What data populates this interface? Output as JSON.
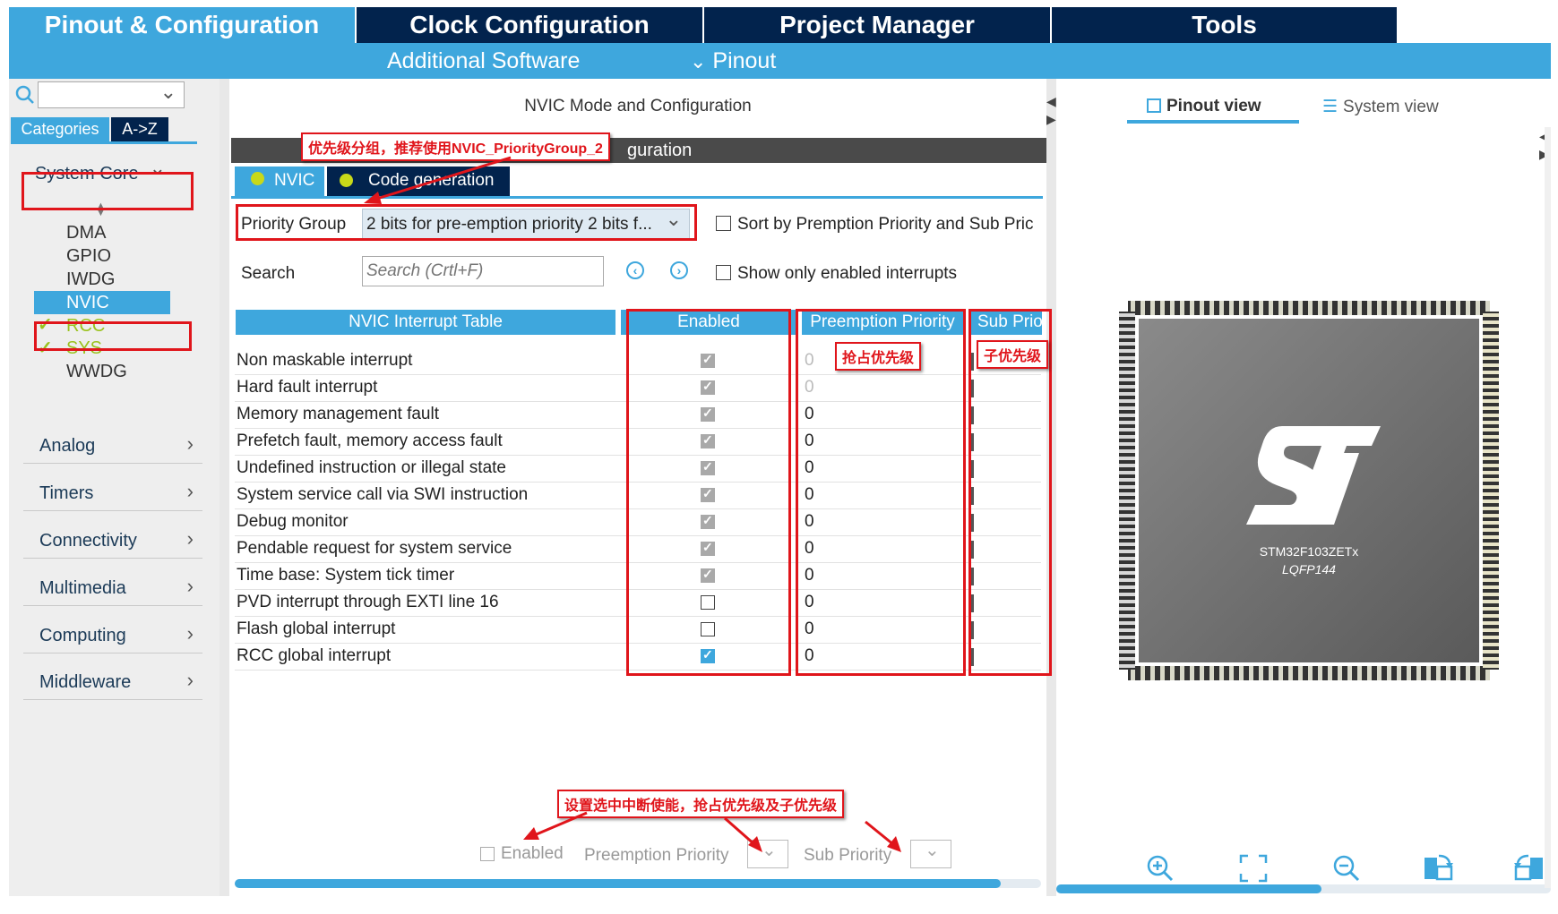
{
  "top_tabs": [
    "Pinout & Configuration",
    "Clock Configuration",
    "Project Manager",
    "Tools"
  ],
  "sub_bar": {
    "additional_software": "Additional Software",
    "pinout": "Pinout"
  },
  "left": {
    "search_placeholder": "",
    "tabs": [
      "Categories",
      "A->Z"
    ],
    "system_core": "System Core",
    "core_items": [
      {
        "label": "DMA",
        "checked": false
      },
      {
        "label": "GPIO",
        "checked": false
      },
      {
        "label": "IWDG",
        "checked": false
      },
      {
        "label": "NVIC",
        "checked": false,
        "selected": true
      },
      {
        "label": "RCC",
        "checked": true
      },
      {
        "label": "SYS",
        "checked": true
      },
      {
        "label": "WWDG",
        "checked": false
      }
    ],
    "categories": [
      "Analog",
      "Timers",
      "Connectivity",
      "Multimedia",
      "Computing",
      "Middleware"
    ]
  },
  "middle": {
    "title": "NVIC Mode and Configuration",
    "section_title_visible": "guration",
    "tabs": [
      "NVIC",
      "Code generation"
    ],
    "priority_group_label": "Priority Group",
    "priority_group_value": "2 bits for pre-emption priority 2 bits f...",
    "sort_label": "Sort by Premption Priority and Sub Pric",
    "search_label": "Search",
    "search_placeholder": "Search (Crtl+F)",
    "show_enabled_label": "Show only enabled interrupts",
    "table_headers": [
      "NVIC Interrupt Table",
      "Enabled",
      "Preemption Priority",
      "Sub Prio"
    ],
    "rows": [
      {
        "name": "Non maskable interrupt",
        "enabled": "locked",
        "pre": "0",
        "pre_dim": true
      },
      {
        "name": "Hard fault interrupt",
        "enabled": "locked",
        "pre": "0",
        "pre_dim": true
      },
      {
        "name": "Memory management fault",
        "enabled": "locked",
        "pre": "0",
        "pre_dim": false
      },
      {
        "name": "Prefetch fault, memory access fault",
        "enabled": "locked",
        "pre": "0",
        "pre_dim": false
      },
      {
        "name": "Undefined instruction or illegal state",
        "enabled": "locked",
        "pre": "0",
        "pre_dim": false
      },
      {
        "name": "System service call via SWI instruction",
        "enabled": "locked",
        "pre": "0",
        "pre_dim": false
      },
      {
        "name": "Debug monitor",
        "enabled": "locked",
        "pre": "0",
        "pre_dim": false
      },
      {
        "name": "Pendable request for system service",
        "enabled": "locked",
        "pre": "0",
        "pre_dim": false
      },
      {
        "name": "Time base: System tick timer",
        "enabled": "locked",
        "pre": "0",
        "pre_dim": false
      },
      {
        "name": "PVD interrupt through EXTI line 16",
        "enabled": "off",
        "pre": "0",
        "pre_dim": false
      },
      {
        "name": "Flash global interrupt",
        "enabled": "off",
        "pre": "0",
        "pre_dim": false
      },
      {
        "name": "RCC global interrupt",
        "enabled": "on",
        "pre": "0",
        "pre_dim": false
      }
    ],
    "bottom": {
      "enabled": "Enabled",
      "preemption": "Preemption Priority",
      "sub": "Sub Priority"
    }
  },
  "annotations": {
    "priority_group_note": "优先级分组，推荐使用NVIC_PriorityGroup_2",
    "preempt_note": "抢占优先级",
    "sub_note": "子优先级",
    "bottom_note": "设置选中中断使能，抢占优先级及子优先级"
  },
  "right": {
    "pinout_view": "Pinout view",
    "system_view": "System view",
    "chip_name": "STM32F103ZETx",
    "chip_package": "LQFP144"
  },
  "colors": {
    "accent": "#3ea7dd",
    "dark_tab": "#02234d",
    "annotation_red": "#e0151b",
    "check_green": "#9ac21d"
  }
}
